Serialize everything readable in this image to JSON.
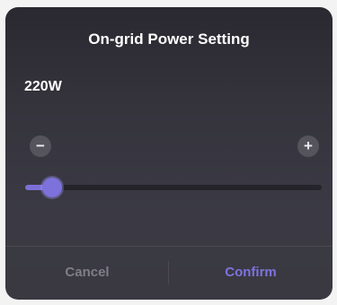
{
  "dialog": {
    "title": "On-grid Power Setting",
    "value_text": "220W"
  },
  "slider": {
    "decrease_label": "−",
    "increase_label": "+",
    "level_fraction": 0.09
  },
  "actions": {
    "cancel_label": "Cancel",
    "confirm_label": "Confirm"
  },
  "colors": {
    "accent": "#7e73dc",
    "background": "#35343d",
    "muted_text": "#7f7e87"
  }
}
